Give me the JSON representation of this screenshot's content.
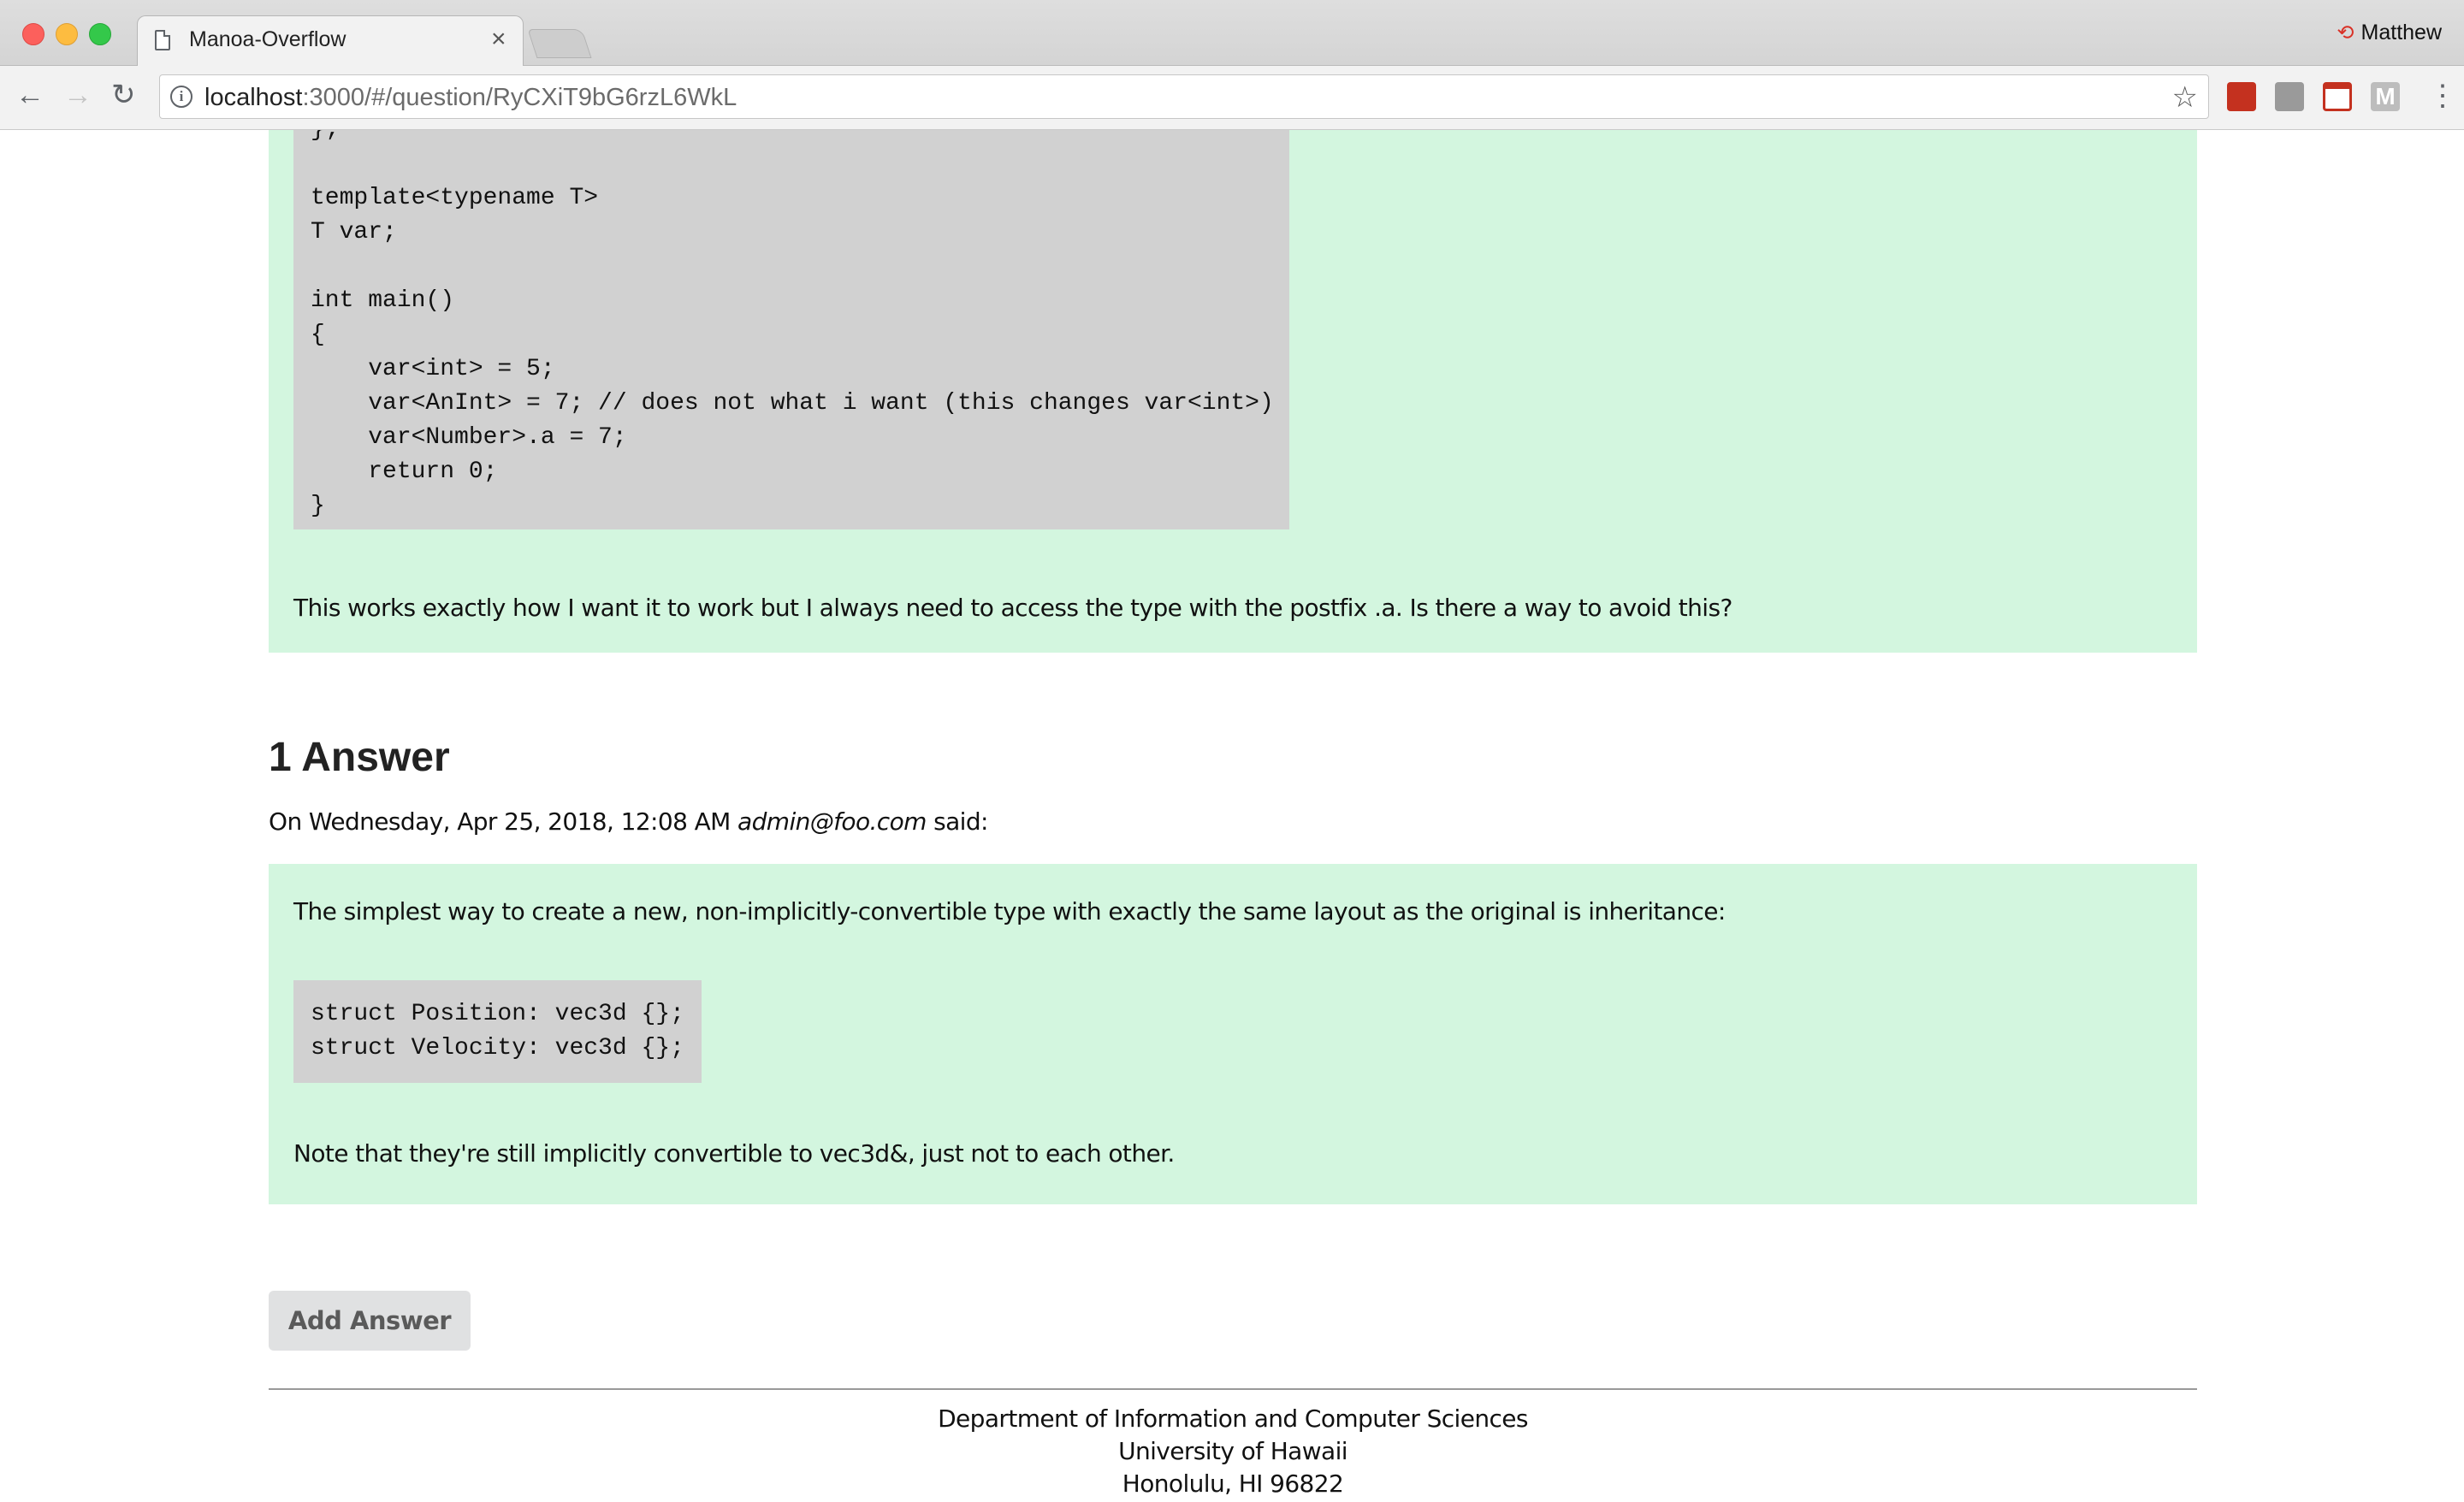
{
  "browser": {
    "tab_title": "Manoa-Overflow",
    "tab_close": "×",
    "profile_name": "Matthew",
    "url_host": "localhost",
    "url_rest": ":3000/#/question/RyCXiT9bG6rzL6WkL",
    "icons": [
      "back-icon",
      "forward-icon",
      "reload-icon",
      "info-icon",
      "bookmark-star-icon",
      "menu-dots-icon"
    ]
  },
  "question": {
    "code_lines": "};\n\ntemplate<typename T>\nT var;\n\nint main()\n{\n    var<int> = 5;\n    var<AnInt> = 7; // does not what i want (this changes var<int>)\n    var<Number>.a = 7;\n    return 0;\n}",
    "closing_text": "This works exactly how I want it to work but I always need to access the type with the postfix .a. Is there a way to avoid this?"
  },
  "answers": {
    "title": "1 Answer",
    "items": [
      {
        "meta_prefix": "On Wednesday, Apr 25, 2018, 12:08 AM",
        "author": "admin@foo.com",
        "meta_suffix": "said:",
        "text1": "The simplest way to create a new, non-implicitly-convertible type with exactly the same layout as the original is inheritance:",
        "code": "struct Position: vec3d {};\nstruct Velocity: vec3d {};",
        "text2": "Note that they're still implicitly convertible to vec3d&, just not to each other."
      }
    ]
  },
  "add_answer_label": "Add Answer",
  "footer": {
    "line1": "Department of Information and Computer Sciences",
    "line2": "University of Hawaii",
    "line3": "Honolulu, HI 96822"
  },
  "colors": {
    "content_box": "#d3f6df",
    "code_bg": "#d1d1d1",
    "button_bg": "#e0e1e2"
  }
}
